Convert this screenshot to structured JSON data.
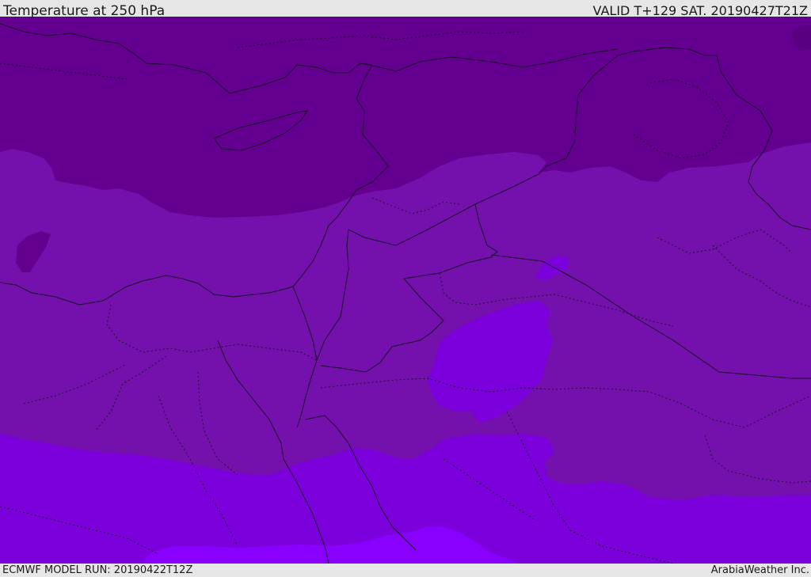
{
  "header": {
    "title": "Temperature at 250 hPa",
    "valid_time": "VALID T+129 SAT. 20190427T21Z"
  },
  "footer": {
    "model_run": "ECMWF MODEL RUN: 20190422T12Z",
    "credit": "ArabiaWeather Inc."
  },
  "map": {
    "colors": {
      "coldest_band": "#63008f",
      "cold_band": "#7410ac",
      "warm_band": "#7c00dc",
      "warmest_band": "#8a00ff",
      "border_lines": "#1a0a2a"
    }
  }
}
